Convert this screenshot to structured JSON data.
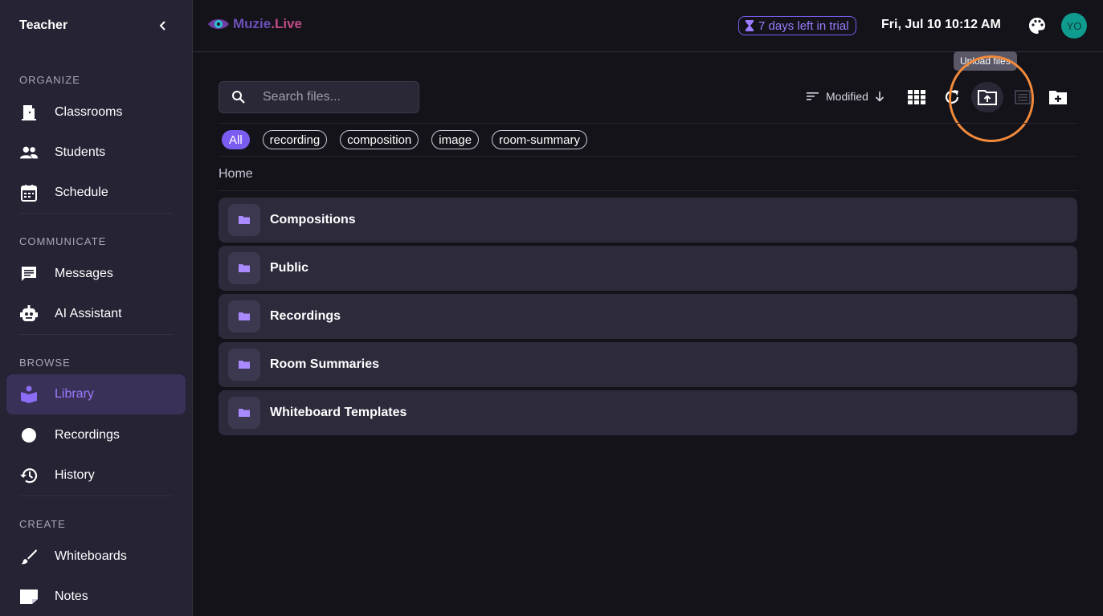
{
  "sidebar": {
    "title": "Teacher",
    "sections": [
      {
        "label": "ORGANIZE",
        "items": [
          {
            "label": "Classrooms",
            "icon": "door-icon"
          },
          {
            "label": "Students",
            "icon": "people-icon"
          },
          {
            "label": "Schedule",
            "icon": "calendar-icon"
          }
        ]
      },
      {
        "label": "COMMUNICATE",
        "items": [
          {
            "label": "Messages",
            "icon": "message-icon"
          },
          {
            "label": "AI Assistant",
            "icon": "robot-icon"
          }
        ]
      },
      {
        "label": "BROWSE",
        "items": [
          {
            "label": "Library",
            "icon": "library-icon",
            "active": true
          },
          {
            "label": "Recordings",
            "icon": "record-icon"
          },
          {
            "label": "History",
            "icon": "history-icon"
          }
        ]
      },
      {
        "label": "CREATE",
        "items": [
          {
            "label": "Whiteboards",
            "icon": "brush-icon"
          },
          {
            "label": "Notes",
            "icon": "note-icon"
          }
        ]
      }
    ]
  },
  "header": {
    "logo_part1": "Muzie",
    "logo_part2": ".Live",
    "trial_text": "7 days left in trial",
    "datetime": "Fri, Jul 10 10:12 AM",
    "avatar_initials": "YO"
  },
  "toolbar": {
    "search_placeholder": "Search files...",
    "sort_label": "Modified",
    "tooltip": "Upload files"
  },
  "filters": [
    "All",
    "recording",
    "composition",
    "image",
    "room-summary"
  ],
  "breadcrumb": "Home",
  "folders": [
    "Compositions",
    "Public",
    "Recordings",
    "Room Summaries",
    "Whiteboard Templates"
  ],
  "colors": {
    "accent": "#7b5cf0",
    "highlight": "#f28a3c",
    "avatar": "#0f9b8e"
  }
}
